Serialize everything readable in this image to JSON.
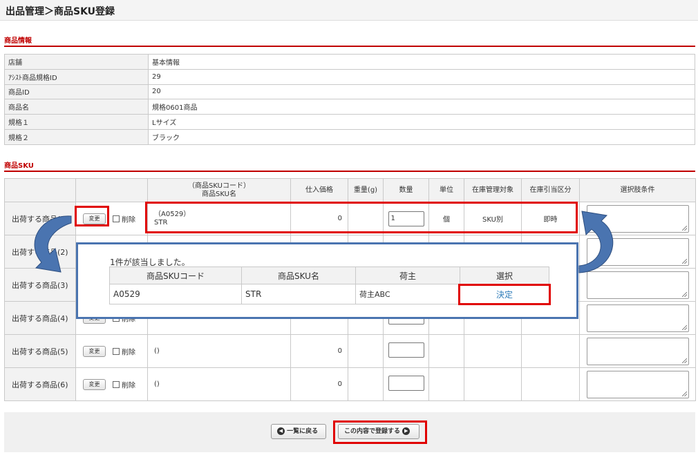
{
  "header": {
    "title": "出品管理＞商品SKU登録"
  },
  "product_info": {
    "section_title": "商品情報",
    "rows": [
      {
        "label": "店舗",
        "value": "基本情報"
      },
      {
        "label": "ｱｼｽﾄ商品規格ID",
        "value": "29"
      },
      {
        "label": "商品ID",
        "value": "20"
      },
      {
        "label": "商品名",
        "value": "規格0601商品"
      },
      {
        "label": "規格１",
        "value": "Lサイズ"
      },
      {
        "label": "規格２",
        "value": "ブラック"
      }
    ]
  },
  "sku": {
    "section_title": "商品SKU",
    "headers": {
      "code_name_line1": "（商品SKUコード）",
      "code_name_line2": "商品SKU名",
      "purchase_price": "仕入価格",
      "weight": "重量(g)",
      "quantity": "数量",
      "unit": "単位",
      "stock_target": "在庫管理対象",
      "stock_deduction": "在庫引当区分",
      "option_condition": "選択肢条件"
    },
    "change_label": "変更",
    "delete_label": "削除",
    "rows": [
      {
        "label": "出荷する商品(1)",
        "code": "（A0529）",
        "name": "STR",
        "price": "0",
        "qty": "1",
        "unit": "個",
        "stock_target": "SKU別",
        "deduction": "即時"
      },
      {
        "label": "出荷する商品(2)",
        "code": "",
        "name": "",
        "price": "",
        "qty": "",
        "unit": "",
        "stock_target": "",
        "deduction": ""
      },
      {
        "label": "出荷する商品(3)",
        "code": "",
        "name": "",
        "price": "",
        "qty": "",
        "unit": "",
        "stock_target": "",
        "deduction": ""
      },
      {
        "label": "出荷する商品(4)",
        "code": "",
        "name": "",
        "price": "",
        "qty": "",
        "unit": "",
        "stock_target": "",
        "deduction": ""
      },
      {
        "label": "出荷する商品(5)",
        "code": "()",
        "name": "",
        "price": "0",
        "qty": "",
        "unit": "",
        "stock_target": "",
        "deduction": ""
      },
      {
        "label": "出荷する商品(6)",
        "code": "()",
        "name": "",
        "price": "0",
        "qty": "",
        "unit": "",
        "stock_target": "",
        "deduction": ""
      }
    ]
  },
  "popup": {
    "message": "1件が該当しました。",
    "headers": [
      "商品SKUコード",
      "商品SKU名",
      "荷主",
      "選択"
    ],
    "rows": [
      {
        "code": "A0529",
        "name": "STR",
        "owner": "荷主ABC",
        "select": "決定"
      }
    ]
  },
  "footer": {
    "back_label": "一覧に戻る",
    "register_label": "この内容で登録する"
  },
  "colors": {
    "section_accent": "#c00000",
    "highlight": "#e00000",
    "popup_border": "#4a74b0",
    "arrow_fill": "#4a74b0",
    "link": "#2a7ab8"
  },
  "icons": {
    "back": "left-arrow-circle-icon",
    "register": "right-arrow-circle-icon",
    "resize": "resize-grip-icon"
  }
}
